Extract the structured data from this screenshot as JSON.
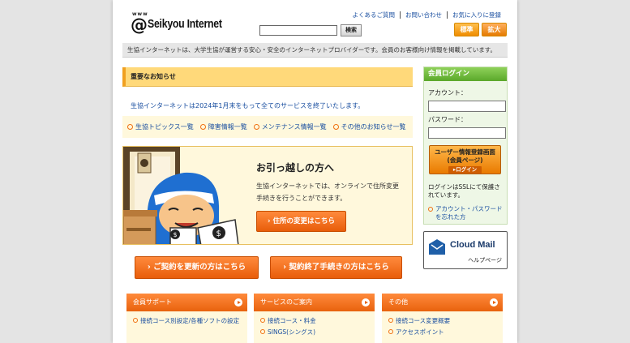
{
  "header": {
    "logo_prefix": "www",
    "logo_at": "@",
    "logo_text": "Seikyou Internet",
    "links": [
      "よくあるご質問",
      "お問い合わせ",
      "お気に入りに登録"
    ],
    "search_placeholder": "",
    "search_button": "検索",
    "size_standard": "標準",
    "size_large": "拡大"
  },
  "tagline": "生協インターネットは、大学生協が運営する安心・安全のインターネットプロバイダーです。会員のお客様向け情報を掲載しています。",
  "notice": {
    "title": "重要なお知らせ",
    "text": "生協インターネットは2024年1月末をもって全てのサービスを終了いたします。",
    "links": [
      "生協トピックス一覧",
      "障害情報一覧",
      "メンテナンス情報一覧",
      "その他のお知らせ一覧"
    ]
  },
  "moving": {
    "title": "お引っ越しの方へ",
    "text": "生協インターネットでは、オンラインで住所変更手続きを行うことができます。",
    "button": "› 住所の変更はこちら"
  },
  "buttons": {
    "renew": "› ご契約を更新の方はこちら",
    "terminate": "› 契約終了手続きの方はこちら"
  },
  "login": {
    "title": "会員ログイン",
    "account_label": "アカウント：",
    "password_label": "パスワード：",
    "button_line1": "ユーザー情報登録画面",
    "button_line2": "(会員ページ)",
    "button_sub": "▸ログイン",
    "ssl_note": "ログインはSSLにて保護されています。",
    "forgot": "アカウント・パスワードを忘れた方"
  },
  "cloudmail": {
    "title": "Cloud Mail",
    "subtitle": "ヘルプページ"
  },
  "columns": [
    {
      "title": "会員サポート",
      "items": [
        "接続コース別設定/各種ソフトの設定"
      ]
    },
    {
      "title": "サービスのご案内",
      "items": [
        "接続コース・料金",
        "SINGS(シングス)"
      ]
    },
    {
      "title": "その他",
      "items": [
        "接続コース変更概要",
        "アクセスポイント"
      ]
    }
  ],
  "colors": {
    "accent_orange": "#e85d0a",
    "link_blue": "#1a4fa0",
    "login_green": "#5aa82a",
    "notice_yellow": "#ffd97a"
  }
}
